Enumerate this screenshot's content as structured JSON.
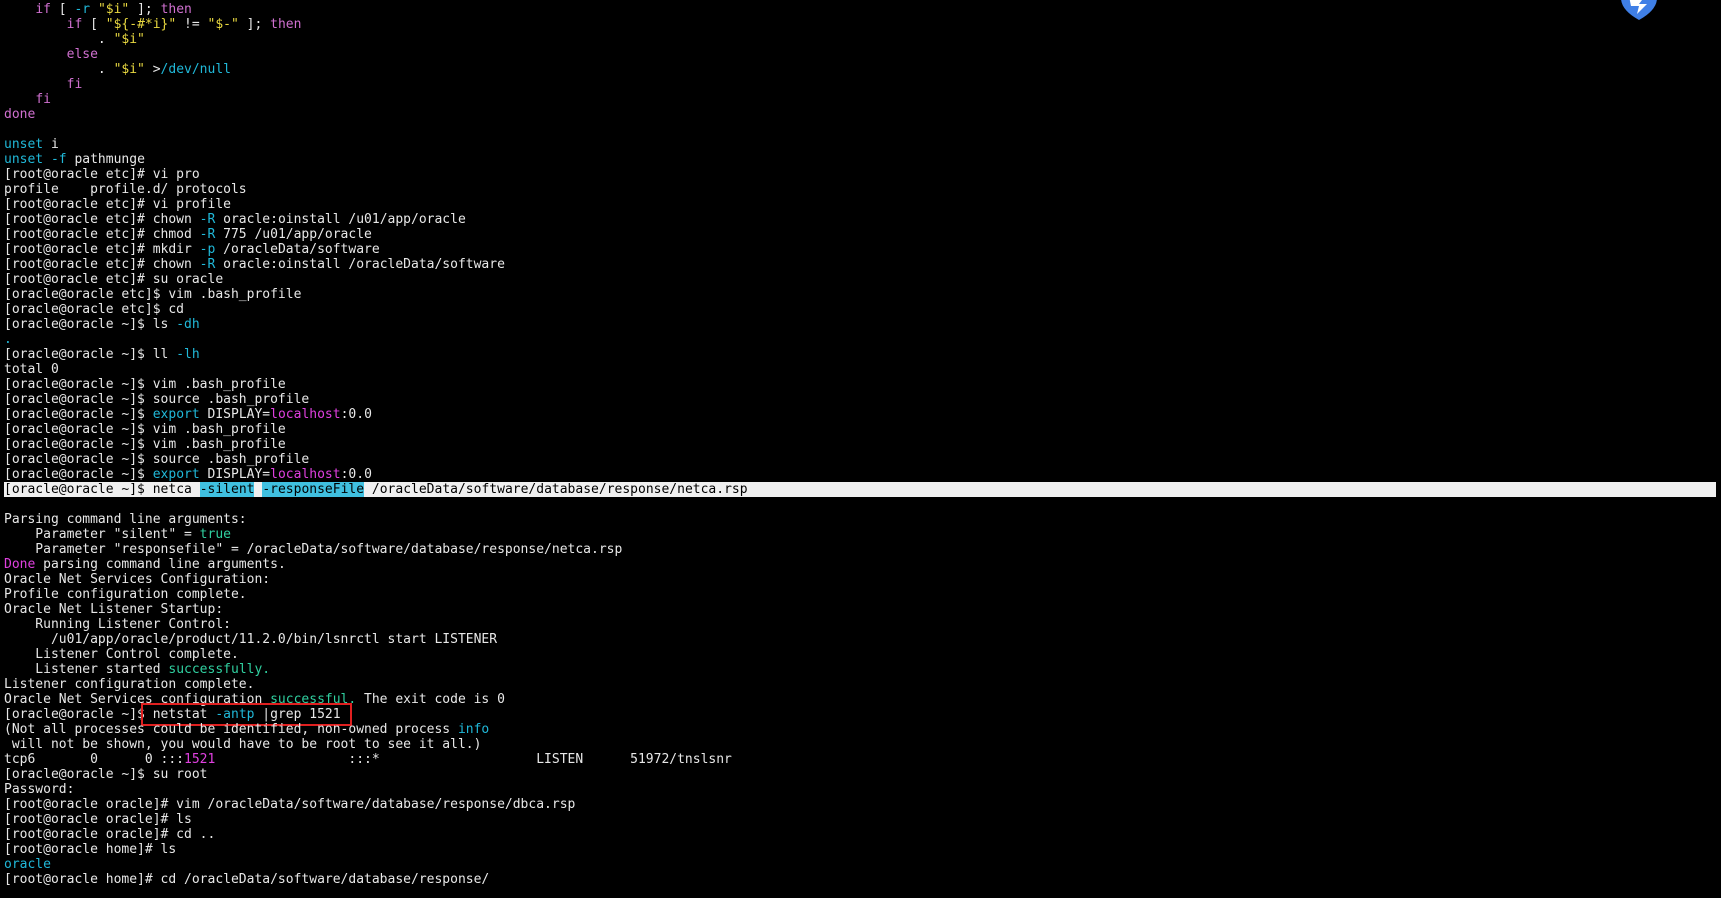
{
  "colors": {
    "background": "#000000",
    "default_text": "#e8e8e8",
    "keyword": "#d070d0",
    "string": "#e8d840",
    "option": "#20b8d8",
    "value": "#e040e0",
    "success": "#30d0a0",
    "highlight_bg": "#f0f0f0",
    "highlight_text": "#000000",
    "highlight_option_bg": "#40c0e0",
    "box_outline": "#e02020"
  },
  "corner_icon": "app-logo-icon",
  "lines": [
    {
      "segments": [
        {
          "t": "    "
        },
        {
          "t": "if",
          "c": "keyword"
        },
        {
          "t": " [ "
        },
        {
          "t": "-r",
          "c": "option"
        },
        {
          "t": " "
        },
        {
          "t": "\"$i\"",
          "c": "string"
        },
        {
          "t": " ]; "
        },
        {
          "t": "then",
          "c": "keyword"
        }
      ]
    },
    {
      "segments": [
        {
          "t": "        "
        },
        {
          "t": "if",
          "c": "keyword"
        },
        {
          "t": " [ "
        },
        {
          "t": "\"${-#*i}\"",
          "c": "string"
        },
        {
          "t": " != "
        },
        {
          "t": "\"$-\"",
          "c": "string"
        },
        {
          "t": " ]; "
        },
        {
          "t": "then",
          "c": "keyword"
        }
      ]
    },
    {
      "segments": [
        {
          "t": "            . "
        },
        {
          "t": "\"$i\"",
          "c": "string"
        }
      ]
    },
    {
      "segments": [
        {
          "t": "        "
        },
        {
          "t": "else",
          "c": "keyword"
        }
      ]
    },
    {
      "segments": [
        {
          "t": "            . "
        },
        {
          "t": "\"$i\"",
          "c": "string"
        },
        {
          "t": " >"
        },
        {
          "t": "/dev/null",
          "c": "option"
        }
      ]
    },
    {
      "segments": [
        {
          "t": "        "
        },
        {
          "t": "fi",
          "c": "keyword"
        }
      ]
    },
    {
      "segments": [
        {
          "t": "    "
        },
        {
          "t": "fi",
          "c": "keyword"
        }
      ]
    },
    {
      "segments": [
        {
          "t": "done",
          "c": "keyword"
        }
      ]
    },
    {
      "segments": []
    },
    {
      "segments": [
        {
          "t": "unset",
          "c": "option"
        },
        {
          "t": " i"
        }
      ]
    },
    {
      "segments": [
        {
          "t": "unset",
          "c": "option"
        },
        {
          "t": " "
        },
        {
          "t": "-f",
          "c": "option"
        },
        {
          "t": " pathmunge"
        }
      ]
    },
    {
      "segments": [
        {
          "t": "[root@oracle etc]# vi pro"
        }
      ]
    },
    {
      "segments": [
        {
          "t": "profile    profile.d/ protocols"
        }
      ]
    },
    {
      "segments": [
        {
          "t": "[root@oracle etc]# vi profile"
        }
      ]
    },
    {
      "segments": [
        {
          "t": "[root@oracle etc]# chown "
        },
        {
          "t": "-R",
          "c": "option"
        },
        {
          "t": " oracle:oinstall /u01/app/oracle"
        }
      ]
    },
    {
      "segments": [
        {
          "t": "[root@oracle etc]# chmod "
        },
        {
          "t": "-R",
          "c": "option"
        },
        {
          "t": " 775 /u01/app/oracle"
        }
      ]
    },
    {
      "segments": [
        {
          "t": "[root@oracle etc]# mkdir "
        },
        {
          "t": "-p",
          "c": "option"
        },
        {
          "t": " /oracleData/software"
        }
      ]
    },
    {
      "segments": [
        {
          "t": "[root@oracle etc]# chown "
        },
        {
          "t": "-R",
          "c": "option"
        },
        {
          "t": " oracle:oinstall /oracleData/software"
        }
      ]
    },
    {
      "segments": [
        {
          "t": "[root@oracle etc]# su oracle"
        }
      ]
    },
    {
      "segments": [
        {
          "t": "[oracle@oracle etc]$ vim .bash_profile"
        }
      ]
    },
    {
      "segments": [
        {
          "t": "[oracle@oracle etc]$ cd"
        }
      ]
    },
    {
      "segments": [
        {
          "t": "[oracle@oracle ~]$ ls "
        },
        {
          "t": "-dh",
          "c": "option"
        }
      ]
    },
    {
      "segments": [
        {
          "t": ".",
          "c": "option"
        }
      ]
    },
    {
      "segments": [
        {
          "t": "[oracle@oracle ~]$ ll "
        },
        {
          "t": "-lh",
          "c": "option"
        }
      ]
    },
    {
      "segments": [
        {
          "t": "total 0"
        }
      ]
    },
    {
      "segments": [
        {
          "t": "[oracle@oracle ~]$ vim .bash_profile"
        }
      ]
    },
    {
      "segments": [
        {
          "t": "[oracle@oracle ~]$ source .bash_profile"
        }
      ]
    },
    {
      "segments": [
        {
          "t": "[oracle@oracle ~]$ "
        },
        {
          "t": "export",
          "c": "option"
        },
        {
          "t": " DISPLAY="
        },
        {
          "t": "localhost",
          "c": "value"
        },
        {
          "t": ":0.0"
        }
      ]
    },
    {
      "segments": [
        {
          "t": "[oracle@oracle ~]$ vim .bash_profile"
        }
      ]
    },
    {
      "segments": [
        {
          "t": "[oracle@oracle ~]$ vim .bash_profile"
        }
      ]
    },
    {
      "segments": [
        {
          "t": "[oracle@oracle ~]$ source .bash_profile"
        }
      ]
    },
    {
      "segments": [
        {
          "t": "[oracle@oracle ~]$ "
        },
        {
          "t": "export",
          "c": "option"
        },
        {
          "t": " DISPLAY="
        },
        {
          "t": "localhost",
          "c": "value"
        },
        {
          "t": ":0.0"
        }
      ]
    },
    {
      "highlight": true,
      "segments": [
        {
          "t": "[oracle@oracle ~]$",
          "c": "plain_dark"
        },
        {
          "t": " netca ",
          "c": "hl"
        },
        {
          "t": "-silent",
          "c": "hlopt"
        },
        {
          "t": " ",
          "c": "hl"
        },
        {
          "t": "-responseFile",
          "c": "hlopt"
        },
        {
          "t": " /oracleData/software/database/response/netca.rsp",
          "c": "hl"
        }
      ]
    },
    {
      "segments": []
    },
    {
      "segments": [
        {
          "t": "Parsing command line arguments:"
        }
      ]
    },
    {
      "segments": [
        {
          "t": "    Parameter \"silent\" = "
        },
        {
          "t": "true",
          "c": "success"
        }
      ]
    },
    {
      "segments": [
        {
          "t": "    Parameter \"responsefile\" = /oracleData/software/database/response/netca.rsp"
        }
      ]
    },
    {
      "segments": [
        {
          "t": "Done",
          "c": "value"
        },
        {
          "t": " parsing command line arguments."
        }
      ]
    },
    {
      "segments": [
        {
          "t": "Oracle Net Services Configuration:"
        }
      ]
    },
    {
      "segments": [
        {
          "t": "Profile configuration complete."
        }
      ]
    },
    {
      "segments": [
        {
          "t": "Oracle Net Listener Startup:"
        }
      ]
    },
    {
      "segments": [
        {
          "t": "    Running Listener Control:"
        }
      ]
    },
    {
      "segments": [
        {
          "t": "      /u01/app/oracle/product/11.2.0/bin/lsnrctl start LISTENER"
        }
      ]
    },
    {
      "segments": [
        {
          "t": "    Listener Control complete."
        }
      ]
    },
    {
      "segments": [
        {
          "t": "    Listener started "
        },
        {
          "t": "successfully.",
          "c": "success"
        }
      ]
    },
    {
      "segments": [
        {
          "t": "Listener configuration complete."
        }
      ]
    },
    {
      "segments": [
        {
          "t": "Oracle Net Services configuration "
        },
        {
          "t": "successful.",
          "c": "success"
        },
        {
          "t": " The exit code is 0"
        }
      ]
    },
    {
      "segments": [
        {
          "t": "[oracle@oracle ~]$"
        },
        {
          "t": " netstat ",
          "box": true
        },
        {
          "t": "-antp",
          "c": "option",
          "box": true
        },
        {
          "t": " |grep 1521 ",
          "box": true
        }
      ]
    },
    {
      "segments": [
        {
          "t": "(Not all processes could be identified, non-owned process "
        },
        {
          "t": "info",
          "c": "option"
        }
      ]
    },
    {
      "segments": [
        {
          "t": " will not be shown, you would have to be root to see it all.)"
        }
      ]
    },
    {
      "segments": [
        {
          "t": "tcp6       0      0 :::"
        },
        {
          "t": "1521",
          "c": "value"
        },
        {
          "t": "                 :::*                    LISTEN      51972/tnslsnr"
        }
      ]
    },
    {
      "segments": [
        {
          "t": "[oracle@oracle ~]$ su root"
        }
      ]
    },
    {
      "segments": [
        {
          "t": "Password:"
        }
      ]
    },
    {
      "segments": [
        {
          "t": "[root@oracle oracle]# vim /oracleData/software/database/response/dbca.rsp"
        }
      ]
    },
    {
      "segments": [
        {
          "t": "[root@oracle oracle]# ls"
        }
      ]
    },
    {
      "segments": [
        {
          "t": "[root@oracle oracle]# cd .."
        }
      ]
    },
    {
      "segments": [
        {
          "t": "[root@oracle home]# ls"
        }
      ]
    },
    {
      "segments": [
        {
          "t": "oracle",
          "c": "option"
        }
      ]
    },
    {
      "segments": [
        {
          "t": "[root@oracle home]# cd /oracleData/software/database/response/"
        }
      ]
    }
  ]
}
